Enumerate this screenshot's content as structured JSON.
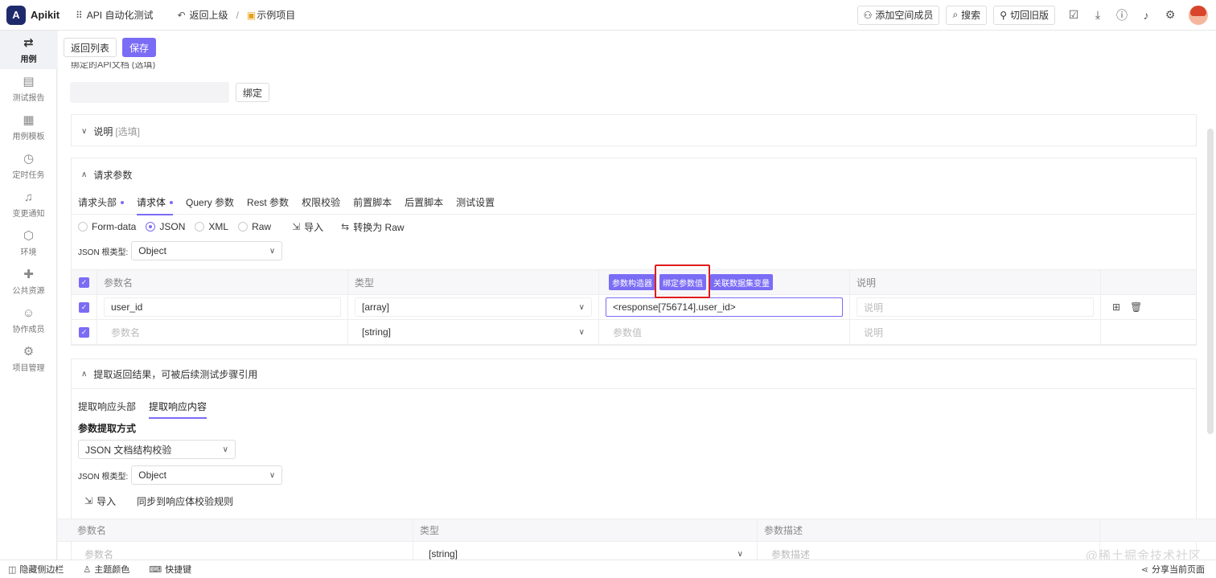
{
  "app": {
    "name": "Apikit",
    "logo_letter": "A"
  },
  "topbar": {
    "workspace": "API 自动化测试",
    "back": "返回上级",
    "sep": "/",
    "project": "示例项目",
    "add_member": "添加空间成员",
    "search": "搜索",
    "switch_old": "切回旧版"
  },
  "sidebar": {
    "items": [
      {
        "label": "用例",
        "icon": "swap-icon"
      },
      {
        "label": "测试报告",
        "icon": "report-icon"
      },
      {
        "label": "用例模板",
        "icon": "template-icon"
      },
      {
        "label": "定时任务",
        "icon": "timer-icon"
      },
      {
        "label": "变更通知",
        "icon": "bell-icon"
      },
      {
        "label": "环境",
        "icon": "env-icon"
      },
      {
        "label": "公共资源",
        "icon": "puzzle-icon"
      },
      {
        "label": "协作成员",
        "icon": "users-icon"
      },
      {
        "label": "项目管理",
        "icon": "gear-icon"
      }
    ]
  },
  "toolbar": {
    "back_list": "返回列表",
    "save": "保存"
  },
  "bound_api": {
    "label": "绑定的API文档 (选填)",
    "bind_btn": "绑定"
  },
  "desc_panel": {
    "title": "说明",
    "optional": "[选填]"
  },
  "request": {
    "title": "请求参数",
    "tabs": [
      "请求头部",
      "请求体",
      "Query 参数",
      "Rest 参数",
      "权限校验",
      "前置脚本",
      "后置脚本",
      "测试设置"
    ],
    "formats": [
      "Form-data",
      "JSON",
      "XML",
      "Raw"
    ],
    "import": "导入",
    "convert_raw": "转换为 Raw",
    "root_type_label": "JSON 根类型:",
    "root_type_value": "Object",
    "columns": {
      "name": "参数名",
      "type": "类型",
      "desc": "说明"
    },
    "value_tools": [
      "参数构造器",
      "绑定参数值",
      "关联数据集变量"
    ],
    "rows": [
      {
        "name": "user_id",
        "type": "[array]",
        "value": "<response[756714].user_id>",
        "desc": "说明"
      }
    ],
    "new_row": {
      "name": "参数名",
      "type": "[string]",
      "value": "参数值",
      "desc": "说明"
    }
  },
  "extract": {
    "title": "提取返回结果，可被后续测试步骤引用",
    "tabs": [
      "提取响应头部",
      "提取响应内容"
    ],
    "method_label": "参数提取方式",
    "method_value": "JSON 文档结构校验",
    "root_type_label": "JSON 根类型:",
    "root_type_value": "Object",
    "import": "导入",
    "sync": "同步到响应体校验规则",
    "columns": {
      "name": "参数名",
      "type": "类型",
      "desc": "参数描述"
    },
    "new_row": {
      "name": "参数名",
      "type": "[string]",
      "desc": "参数描述"
    }
  },
  "bottombar": {
    "hide_sidebar": "隐藏侧边栏",
    "theme": "主题颜色",
    "shortcuts": "快捷键",
    "share": "分享当前页面"
  },
  "watermark": "@稀土掘金技术社区",
  "colors": {
    "accent": "#7b6cf6",
    "highlight": "#e01b1b",
    "logo": "#1e2a6b"
  }
}
